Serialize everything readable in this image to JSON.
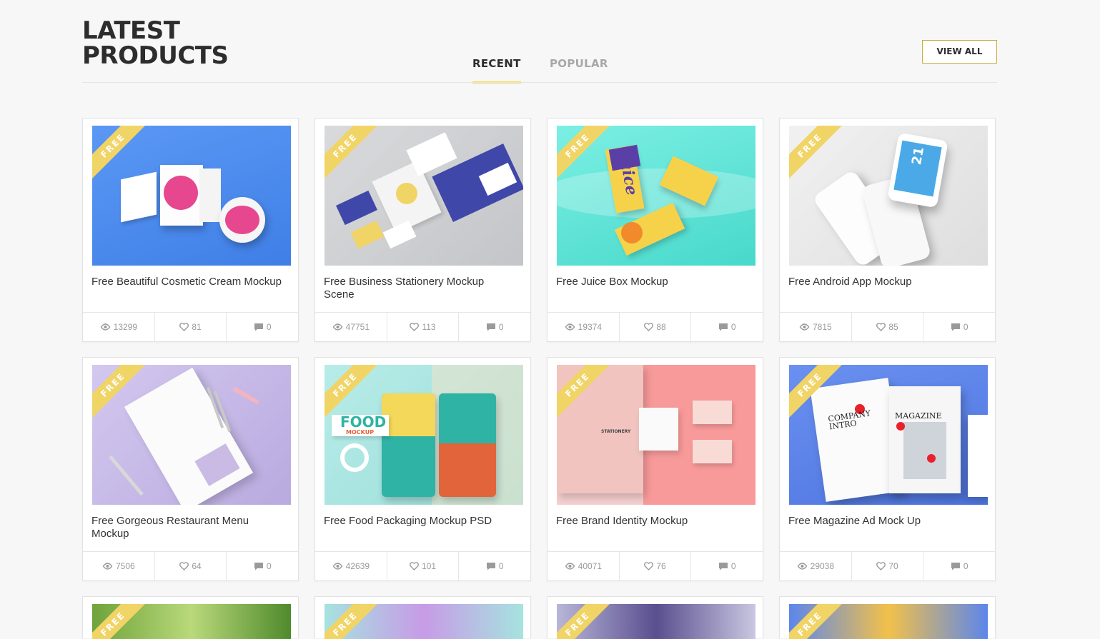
{
  "header": {
    "title": "LATEST PRODUCTS",
    "tabs": [
      {
        "label": "RECENT",
        "active": true
      },
      {
        "label": "POPULAR",
        "active": false
      }
    ],
    "view_all_label": "VIEW ALL"
  },
  "colors": {
    "accent": "#f1d466",
    "view_all_border": "#c9ad3b",
    "stat_text": "#9a9a9a"
  },
  "ribbon_label": "FREE",
  "products": [
    {
      "title": "Free Beautiful Cosmetic Cream Mockup",
      "views": "13299",
      "likes": "81",
      "comments": "0"
    },
    {
      "title": "Free Business Stationery Mockup Scene",
      "views": "47751",
      "likes": "113",
      "comments": "0"
    },
    {
      "title": "Free Juice Box Mockup",
      "views": "19374",
      "likes": "88",
      "comments": "0"
    },
    {
      "title": "Free Android App Mockup",
      "views": "7815",
      "likes": "85",
      "comments": "0"
    },
    {
      "title": "Free Gorgeous Restaurant Menu Mockup",
      "views": "7506",
      "likes": "64",
      "comments": "0"
    },
    {
      "title": "Free Food Packaging Mockup PSD",
      "views": "42639",
      "likes": "101",
      "comments": "0"
    },
    {
      "title": "Free Brand Identity Mockup",
      "views": "40071",
      "likes": "76",
      "comments": "0"
    },
    {
      "title": "Free Magazine Ad Mock Up",
      "views": "29038",
      "likes": "70",
      "comments": "0"
    }
  ],
  "thumbnail_texts": {
    "juice_label": "juice",
    "food_label": "FOOD",
    "food_mockup": "MOCKUP",
    "stationery_label": "STATIONERY",
    "company_intro": "COMPANY INTRO",
    "magazine": "MAGAZINE",
    "phone_date": "21"
  },
  "icons": {
    "views": "eye-icon",
    "likes": "heart-icon",
    "comments": "comment-icon"
  }
}
